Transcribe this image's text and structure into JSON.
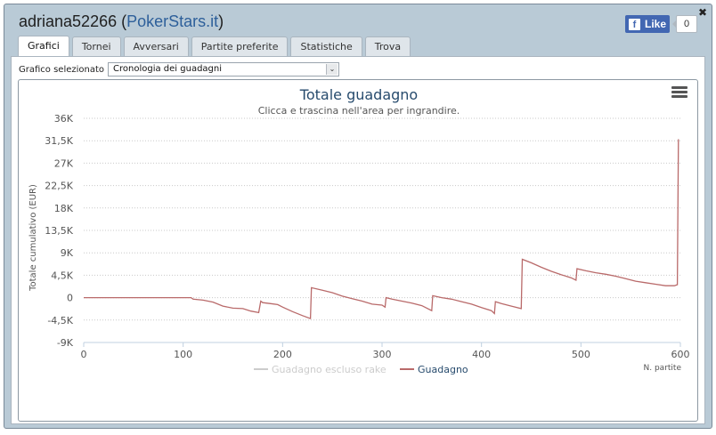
{
  "window": {
    "username": "adriana52266",
    "open_paren": " (",
    "site": "PokerStars.it",
    "close_paren": ")",
    "close_glyph": "✖"
  },
  "facebook": {
    "like_label": "Like",
    "count": "0",
    "icon": "facebook-f-icon"
  },
  "tabs": [
    {
      "label": "Grafici",
      "active": true
    },
    {
      "label": "Tornei",
      "active": false
    },
    {
      "label": "Avversari",
      "active": false
    },
    {
      "label": "Partite preferite",
      "active": false
    },
    {
      "label": "Statistiche",
      "active": false
    },
    {
      "label": "Trova",
      "active": false
    }
  ],
  "selector": {
    "label": "Grafico selezionato",
    "value": "Cronologia dei guadagni",
    "arrow_glyph": "⌄"
  },
  "chart_data": {
    "type": "line",
    "title": "Totale guadagno",
    "subtitle": "Clicca e trascina nell'area per ingrandire.",
    "ylabel": "Totale cumulativo (EUR)",
    "xlabel": "N. partite",
    "xlim": [
      0,
      600
    ],
    "ylim": [
      -9000,
      36000
    ],
    "x_ticks": [
      0,
      100,
      200,
      300,
      400,
      500,
      600
    ],
    "x_tick_labels": [
      "0",
      "100",
      "200",
      "300",
      "400",
      "500",
      "600"
    ],
    "y_ticks": [
      -9000,
      -4500,
      0,
      4500,
      9000,
      13500,
      18000,
      22500,
      27000,
      31500,
      36000
    ],
    "y_tick_labels": [
      "-9K",
      "-4,5K",
      "0",
      "4,5K",
      "9K",
      "13,5K",
      "18K",
      "22,5K",
      "27K",
      "31,5K",
      "36K"
    ],
    "grid": "horizontal dotted",
    "legend_position": "bottom-center",
    "colors": {
      "guadagno": "#b96a6a",
      "escluso_rake": "#cccccc",
      "text": "#555555",
      "title": "#274b6d"
    },
    "series": [
      {
        "name": "Guadagno escluso rake",
        "color": "#cccccc",
        "visible": false,
        "points": []
      },
      {
        "name": "Guadagno",
        "color": "#b96a6a",
        "visible": true,
        "points": [
          [
            0,
            0
          ],
          [
            50,
            0
          ],
          [
            100,
            0
          ],
          [
            108,
            0
          ],
          [
            110,
            -300
          ],
          [
            120,
            -500
          ],
          [
            130,
            -900
          ],
          [
            140,
            -1700
          ],
          [
            150,
            -2100
          ],
          [
            160,
            -2200
          ],
          [
            168,
            -2700
          ],
          [
            176,
            -3000
          ],
          [
            178,
            -700
          ],
          [
            180,
            -1000
          ],
          [
            188,
            -1200
          ],
          [
            195,
            -1400
          ],
          [
            200,
            -1900
          ],
          [
            210,
            -2800
          ],
          [
            220,
            -3600
          ],
          [
            228,
            -4200
          ],
          [
            229,
            2000
          ],
          [
            240,
            1500
          ],
          [
            250,
            1000
          ],
          [
            260,
            300
          ],
          [
            270,
            -200
          ],
          [
            280,
            -700
          ],
          [
            290,
            -1300
          ],
          [
            300,
            -1500
          ],
          [
            303,
            -1900
          ],
          [
            304,
            0
          ],
          [
            310,
            -300
          ],
          [
            320,
            -700
          ],
          [
            330,
            -1100
          ],
          [
            340,
            -1600
          ],
          [
            350,
            -2600
          ],
          [
            351,
            400
          ],
          [
            360,
            0
          ],
          [
            370,
            -300
          ],
          [
            380,
            -800
          ],
          [
            390,
            -1300
          ],
          [
            400,
            -2000
          ],
          [
            410,
            -2600
          ],
          [
            413,
            -3200
          ],
          [
            414,
            -800
          ],
          [
            420,
            -1200
          ],
          [
            430,
            -1700
          ],
          [
            440,
            -2200
          ],
          [
            441,
            7700
          ],
          [
            450,
            7000
          ],
          [
            460,
            6100
          ],
          [
            470,
            5300
          ],
          [
            480,
            4600
          ],
          [
            490,
            4000
          ],
          [
            495,
            3500
          ],
          [
            496,
            5800
          ],
          [
            505,
            5400
          ],
          [
            515,
            5000
          ],
          [
            525,
            4700
          ],
          [
            535,
            4300
          ],
          [
            545,
            3800
          ],
          [
            555,
            3300
          ],
          [
            565,
            3000
          ],
          [
            575,
            2700
          ],
          [
            585,
            2400
          ],
          [
            594,
            2400
          ],
          [
            597,
            2600
          ],
          [
            598,
            31800
          ]
        ]
      }
    ]
  }
}
